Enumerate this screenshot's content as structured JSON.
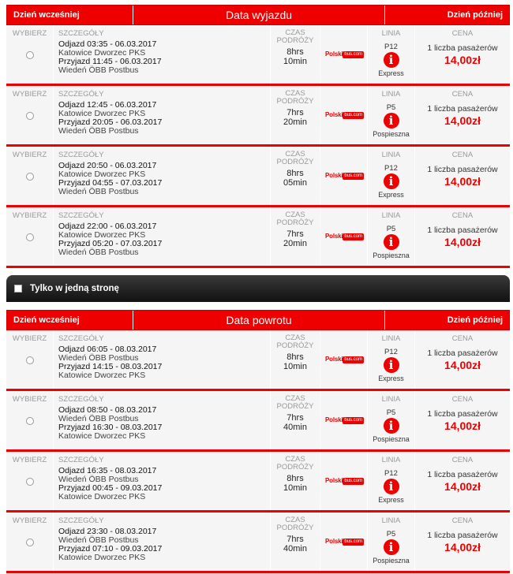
{
  "outbound": {
    "prev_day": "Dzień wcześniej",
    "title": "Data wyjazdu",
    "next_day": "Dzień później",
    "rows": [
      {
        "select_label": "WYBIERZ",
        "details_label": "SZCZEGÓŁY",
        "dep": "Odjazd 03:35 - 06.03.2017",
        "dep_station": "Katowice Dworzec PKS",
        "arr": "Przyjazd 11:45 - 06.03.2017",
        "arr_station": "Wiedeń ÖBB Postbus",
        "time_label1": "CZAS",
        "time_label2": "PODRÓŻY",
        "hrs": "8hrs",
        "mins": "10min",
        "line_label": "LINIA",
        "line_code": "P12",
        "line_type": "Express",
        "price_label": "CENA",
        "passengers": "1 liczba pasażerów",
        "price": "14,00zł"
      },
      {
        "select_label": "WYBIERZ",
        "details_label": "SZCZEGÓŁY",
        "dep": "Odjazd 12:45 - 06.03.2017",
        "dep_station": "Katowice Dworzec PKS",
        "arr": "Przyjazd 20:05 - 06.03.2017",
        "arr_station": "Wiedeń ÖBB Postbus",
        "time_label1": "CZAS",
        "time_label2": "PODRÓŻY",
        "hrs": "7hrs",
        "mins": "20min",
        "line_label": "LINIA",
        "line_code": "P5",
        "line_type": "Pospieszna",
        "price_label": "CENA",
        "passengers": "1 liczba pasażerów",
        "price": "14,00zł"
      },
      {
        "select_label": "WYBIERZ",
        "details_label": "SZCZEGÓŁY",
        "dep": "Odjazd 20:50 - 06.03.2017",
        "dep_station": "Katowice Dworzec PKS",
        "arr": "Przyjazd 04:55 - 07.03.2017",
        "arr_station": "Wiedeń ÖBB Postbus",
        "time_label1": "CZAS",
        "time_label2": "PODRÓŻY",
        "hrs": "8hrs",
        "mins": "05min",
        "line_label": "LINIA",
        "line_code": "P12",
        "line_type": "Express",
        "price_label": "CENA",
        "passengers": "1 liczba pasażerów",
        "price": "14,00zł"
      },
      {
        "select_label": "WYBIERZ",
        "details_label": "SZCZEGÓŁY",
        "dep": "Odjazd 22:00 - 06.03.2017",
        "dep_station": "Katowice Dworzec PKS",
        "arr": "Przyjazd 05:20 - 07.03.2017",
        "arr_station": "Wiedeń ÖBB Postbus",
        "time_label1": "CZAS",
        "time_label2": "PODRÓŻY",
        "hrs": "7hrs",
        "mins": "20min",
        "line_label": "LINIA",
        "line_code": "P5",
        "line_type": "Pospieszna",
        "price_label": "CENA",
        "passengers": "1 liczba pasażerów",
        "price": "14,00zł"
      }
    ]
  },
  "one_way": {
    "label": "Tylko w jedną stronę",
    "checked": false
  },
  "return": {
    "prev_day": "Dzień wcześniej",
    "title": "Data powrotu",
    "next_day": "Dzień później",
    "rows": [
      {
        "select_label": "WYBIERZ",
        "details_label": "SZCZEGÓŁY",
        "dep": "Odjazd 06:05 - 08.03.2017",
        "dep_station": "Wiedeń ÖBB Postbus",
        "arr": "Przyjazd 14:15 - 08.03.2017",
        "arr_station": "Katowice Dworzec PKS",
        "time_label1": "CZAS",
        "time_label2": "PODRÓŻY",
        "hrs": "8hrs",
        "mins": "10min",
        "line_label": "LINIA",
        "line_code": "P12",
        "line_type": "Express",
        "price_label": "CENA",
        "passengers": "1 liczba pasażerów",
        "price": "14,00zł"
      },
      {
        "select_label": "WYBIERZ",
        "details_label": "SZCZEGÓŁY",
        "dep": "Odjazd 08:50 - 08.03.2017",
        "dep_station": "Wiedeń ÖBB Postbus",
        "arr": "Przyjazd 16:30 - 08.03.2017",
        "arr_station": "Katowice Dworzec PKS",
        "time_label1": "CZAS",
        "time_label2": "PODRÓŻY",
        "hrs": "7hrs",
        "mins": "40min",
        "line_label": "LINIA",
        "line_code": "P5",
        "line_type": "Pospieszna",
        "price_label": "CENA",
        "passengers": "1 liczba pasażerów",
        "price": "14,00zł"
      },
      {
        "select_label": "WYBIERZ",
        "details_label": "SZCZEGÓŁY",
        "dep": "Odjazd 16:35 - 08.03.2017",
        "dep_station": "Wiedeń ÖBB Postbus",
        "arr": "Przyjazd 00:45 - 09.03.2017",
        "arr_station": "Katowice Dworzec PKS",
        "time_label1": "CZAS",
        "time_label2": "PODRÓŻY",
        "hrs": "8hrs",
        "mins": "10min",
        "line_label": "LINIA",
        "line_code": "P12",
        "line_type": "Express",
        "price_label": "CENA",
        "passengers": "1 liczba pasażerów",
        "price": "14,00zł"
      },
      {
        "select_label": "WYBIERZ",
        "details_label": "SZCZEGÓŁY",
        "dep": "Odjazd 23:30 - 08.03.2017",
        "dep_station": "Wiedeń ÖBB Postbus",
        "arr": "Przyjazd 07:10 - 09.03.2017",
        "arr_station": "Katowice Dworzec PKS",
        "time_label1": "CZAS",
        "time_label2": "PODRÓŻY",
        "hrs": "7hrs",
        "mins": "40min",
        "line_label": "LINIA",
        "line_code": "P5",
        "line_type": "Pospieszna",
        "price_label": "CENA",
        "passengers": "1 liczba pasażerów",
        "price": "14,00zł"
      }
    ]
  },
  "logo": {
    "text": "Polski",
    "badge": "bus.com"
  },
  "info_glyph": "i",
  "colors": {
    "accent": "#ee0000",
    "bar": "#1a1a1a"
  }
}
